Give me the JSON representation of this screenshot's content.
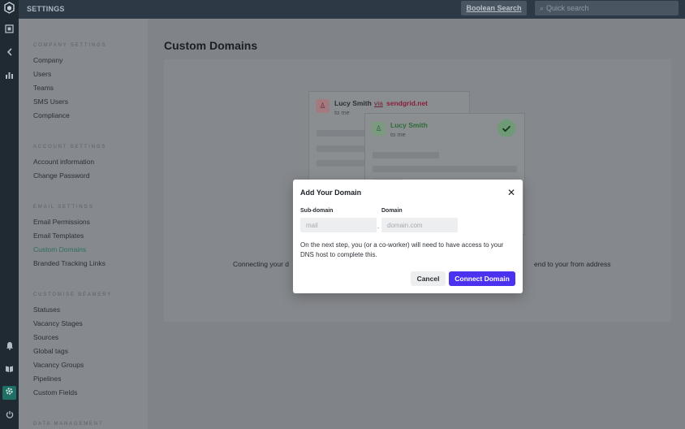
{
  "topbar": {
    "section_title": "SETTINGS",
    "boolean_search_label": "Boolean Search",
    "search_placeholder": "Quick search"
  },
  "rail": {
    "icons": [
      "beamery-logo-icon",
      "inbox-icon",
      "collapse-chevron-icon",
      "analytics-icon",
      "notification-bell-icon",
      "book-icon",
      "settings-gear-icon",
      "power-icon"
    ]
  },
  "sidebar": {
    "company": {
      "heading": "COMPANY SETTINGS",
      "items": [
        "Company",
        "Users",
        "Teams",
        "SMS Users",
        "Compliance"
      ]
    },
    "account": {
      "heading": "ACCOUNT SETTINGS",
      "items": [
        "Account information",
        "Change Password"
      ]
    },
    "email": {
      "heading": "EMAIL SETTINGS",
      "items": [
        "Email Permissions",
        "Email Templates",
        "Custom Domains",
        "Branded Tracking Links"
      ],
      "active": "Custom Domains"
    },
    "customise": {
      "heading": "CUSTOMISE BEAMERY",
      "items": [
        "Statuses",
        "Vacancy Stages",
        "Sources",
        "Global tags",
        "Vacancy Groups",
        "Pipelines",
        "Custom Fields"
      ]
    },
    "data": {
      "heading": "DATA MANAGEMENT"
    }
  },
  "main": {
    "page_title": "Custom Domains",
    "illustration": {
      "back_card": {
        "name": "Lucy Smith",
        "via_word": "via",
        "via_domain": "sendgrid.net",
        "to": "to me"
      },
      "front_card": {
        "name": "Lucy Smith",
        "to": "to me"
      }
    },
    "description_left": "Connecting your d",
    "description_right": "end to your from address"
  },
  "modal": {
    "title": "Add Your Domain",
    "subdomain_label": "Sub-domain",
    "subdomain_placeholder": "mail",
    "subdomain_value": "",
    "separator": ".",
    "domain_label": "Domain",
    "domain_placeholder": "domain.com",
    "domain_value": "",
    "note": "On the next step, you (or a co-worker) will need to have access to your DNS host to complete this.",
    "cancel_label": "Cancel",
    "connect_label": "Connect Domain"
  },
  "colors": {
    "accent_primary": "#4b32ef",
    "active_nav": "#2e6e64",
    "via_domain": "#8a1f3a",
    "verified_green": "#2f6b38"
  }
}
